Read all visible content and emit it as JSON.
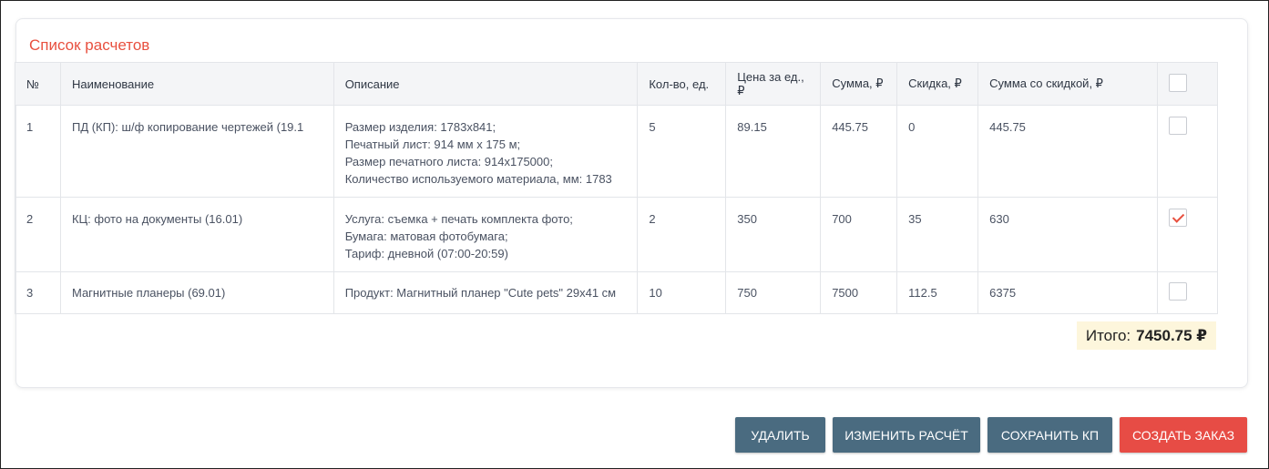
{
  "section": {
    "title": "Список расчетов"
  },
  "table": {
    "headers": [
      "№",
      "Наименование",
      "Описание",
      "Кол-во, ед.",
      "Цена за ед., ₽",
      "Сумма, ₽",
      "Скидка, ₽",
      "Сумма со скидкой, ₽"
    ],
    "rows": [
      {
        "num": "1",
        "name": "ПД (КП): ш/ф копирование чертежей (19.1",
        "description": [
          "Размер изделия: 1783x841;",
          "Печатный лист: 914 мм x 175 м;",
          "Размер печатного листа: 914x175000;",
          "Количество используемого материала, мм: 1783"
        ],
        "qty": "5",
        "price": "89.15",
        "sum": "445.75",
        "discount": "0",
        "sum_discounted": "445.75",
        "checked": false
      },
      {
        "num": "2",
        "name": "КЦ: фото на документы (16.01)",
        "description": [
          "Услуга: съемка + печать комплекта фото;",
          "Бумага: матовая фотобумага;",
          "Тариф: дневной (07:00-20:59)"
        ],
        "qty": "2",
        "price": "350",
        "sum": "700",
        "discount": "35",
        "sum_discounted": "630",
        "checked": true
      },
      {
        "num": "3",
        "name": "Магнитные планеры (69.01)",
        "description": [
          "Продукт: Магнитный планер \"Cute pets\" 29x41 см"
        ],
        "qty": "10",
        "price": "750",
        "sum": "7500",
        "discount": "112.5",
        "sum_discounted": "6375",
        "checked": false
      }
    ]
  },
  "total": {
    "label": "Итого:",
    "value": "7450.75 ₽"
  },
  "buttons": {
    "delete": "Удалить",
    "edit": "Изменить расчёт",
    "save": "Сохранить КП",
    "create": "Создать заказ"
  },
  "colors": {
    "accent_red": "#e8503f",
    "button_dark": "#4a6b80",
    "button_red": "#e74c45",
    "total_bg": "#fdf6dc"
  }
}
